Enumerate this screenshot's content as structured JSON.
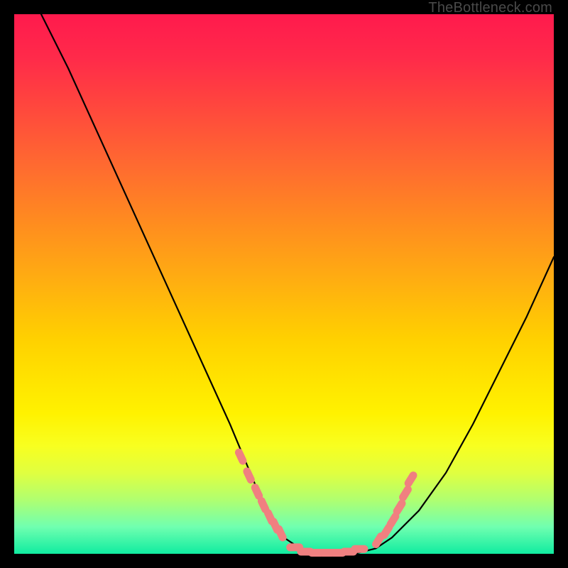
{
  "watermark": "TheBottleneck.com",
  "chart_data": {
    "type": "line",
    "title": "",
    "xlabel": "",
    "ylabel": "",
    "xlim": [
      0,
      100
    ],
    "ylim": [
      0,
      100
    ],
    "grid": false,
    "legend": false,
    "series": [
      {
        "name": "curve",
        "x": [
          5,
          10,
          15,
          20,
          25,
          30,
          35,
          40,
          45,
          47,
          50,
          53,
          56,
          60,
          63,
          67,
          70,
          75,
          80,
          85,
          90,
          95,
          100
        ],
        "y": [
          100,
          90,
          79,
          68,
          57,
          46,
          35,
          24,
          12,
          8,
          3,
          1,
          0,
          0,
          0,
          1,
          3,
          8,
          15,
          24,
          34,
          44,
          55
        ]
      }
    ],
    "markers": {
      "comment": "salmon pill-shaped markers placed near the valley of the curve",
      "color": "#f08080",
      "points_xy": [
        [
          42,
          18
        ],
        [
          43.5,
          14.5
        ],
        [
          45,
          11.5
        ],
        [
          46.2,
          9
        ],
        [
          47.4,
          6.8
        ],
        [
          48.4,
          5.2
        ],
        [
          49.4,
          3.8
        ],
        [
          52,
          1.2
        ],
        [
          54,
          0.4
        ],
        [
          56,
          0.2
        ],
        [
          58,
          0.2
        ],
        [
          60,
          0.2
        ],
        [
          62,
          0.4
        ],
        [
          64,
          0.9
        ],
        [
          67.5,
          2.5
        ],
        [
          69,
          4.2
        ],
        [
          70.2,
          6.2
        ],
        [
          71.4,
          8.6
        ],
        [
          72.5,
          11.2
        ],
        [
          73.5,
          13.8
        ]
      ]
    }
  }
}
